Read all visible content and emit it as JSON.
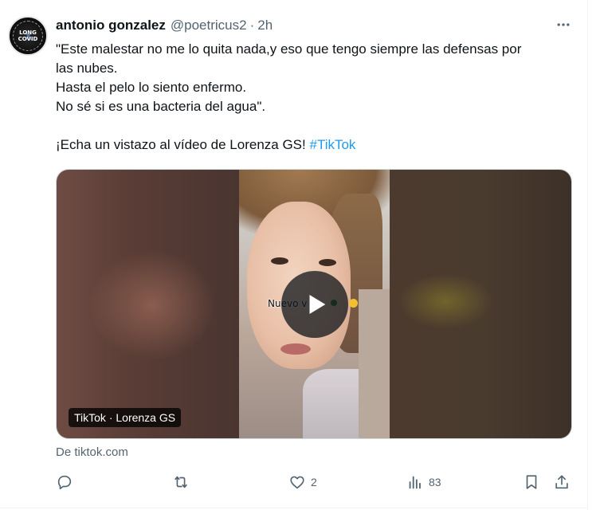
{
  "author": {
    "name": "antonio gonzalez",
    "handle": "@poetricus2",
    "separator": "·",
    "time": "2h",
    "avatar": {
      "text_line1": "LONG",
      "text_line2": "COVID",
      "mark": "X"
    }
  },
  "tweet": {
    "lines": [
      "\"Este malestar no me lo quita nada,y eso que tengo siempre las defensas por",
      "las nubes.",
      "Hasta el pelo lo siento enfermo.",
      "No sé si es una bacteria del agua\"."
    ],
    "cta_text": "¡Echa un vistazo al vídeo de Lorenza GS!",
    "hashtag": "#TikTok"
  },
  "media": {
    "source_badge": "TikTok · Lorenza GS",
    "overlay_caption": "Nuevo v",
    "play_icon": "play-icon"
  },
  "card": {
    "domain_label": "De tiktok.com"
  },
  "actions": {
    "reply": {
      "icon": "reply-icon",
      "count": ""
    },
    "repost": {
      "icon": "repost-icon",
      "count": ""
    },
    "like": {
      "icon": "heart-icon",
      "count": "2"
    },
    "views": {
      "icon": "views-chart-icon",
      "count": "83"
    },
    "bookmark": {
      "icon": "bookmark-icon"
    },
    "share": {
      "icon": "share-icon"
    }
  },
  "colors": {
    "text": "#0f1419",
    "secondary": "#536471",
    "link": "#1d9bf0",
    "border": "#cfd9de"
  }
}
